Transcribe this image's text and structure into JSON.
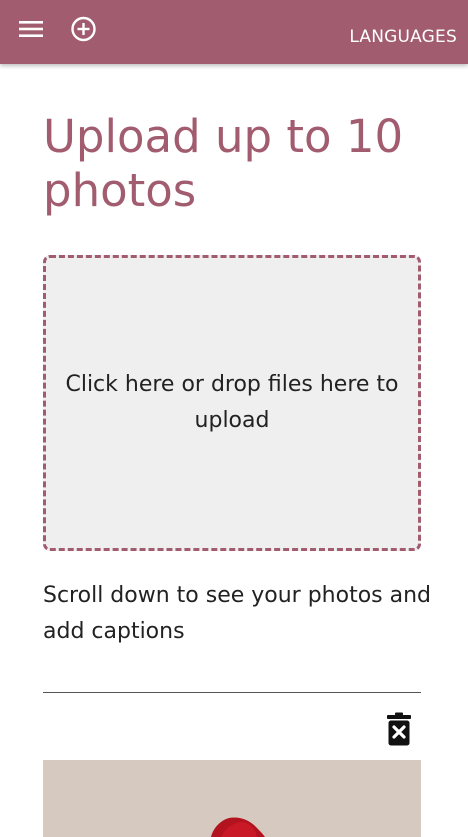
{
  "header": {
    "languages_label": "LANGUAGES",
    "menu_icon": "hamburger-menu-icon",
    "add_icon": "add-circle-icon",
    "background_color": "#a25c6f"
  },
  "main": {
    "title": "Upload up to 10 photos",
    "dropzone_text": "Click here or drop files here to upload",
    "hint_text": "Scroll down to see your photos and add captions"
  },
  "photo_item": {
    "delete_icon": "delete-trash-icon"
  },
  "colors": {
    "accent": "#a25c6f",
    "dropzone_bg": "#efefef",
    "text": "#222222"
  }
}
